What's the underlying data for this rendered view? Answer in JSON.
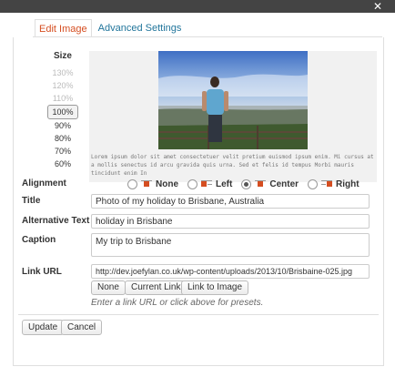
{
  "window": {
    "close_glyph": "✕"
  },
  "tabs": [
    {
      "label": "Edit Image",
      "active": true
    },
    {
      "label": "Advanced Settings",
      "active": false
    }
  ],
  "size": {
    "label": "Size",
    "options": [
      "130%",
      "120%",
      "110%",
      "100%",
      "90%",
      "80%",
      "70%",
      "60%"
    ],
    "selected": "100%"
  },
  "preview": {
    "lorem": "Lorem ipsum dolor sit amet consectetuer velit pretium euismod ipsum enim. Mi cursus at a mollis senectus id arcu gravida quis urna. Sed et felis id tempus Morbi mauris tincidunt enim In"
  },
  "alignment": {
    "label": "Alignment",
    "options": [
      {
        "label": "None",
        "selected": false
      },
      {
        "label": "Left",
        "selected": false
      },
      {
        "label": "Center",
        "selected": true
      },
      {
        "label": "Right",
        "selected": false
      }
    ]
  },
  "fields": {
    "title_label": "Title",
    "title_value": "Photo of my holiday to Brisbane, Australia",
    "alt_label": "Alternative Text",
    "alt_value": "holiday in Brisbane",
    "caption_label": "Caption",
    "caption_value": "My trip to Brisbane",
    "link_label": "Link URL",
    "link_value": "http://dev.joefylan.co.uk/wp-content/uploads/2013/10/Brisbaine-025.jpg"
  },
  "link_buttons": {
    "none": "None",
    "current": "Current Link",
    "image": "Link to Image"
  },
  "hint": "Enter a link URL or click above for presets.",
  "footer": {
    "update": "Update",
    "cancel": "Cancel"
  },
  "colors": {
    "accent": "#d54e21",
    "link": "#21759b",
    "titlebar": "#444444"
  }
}
